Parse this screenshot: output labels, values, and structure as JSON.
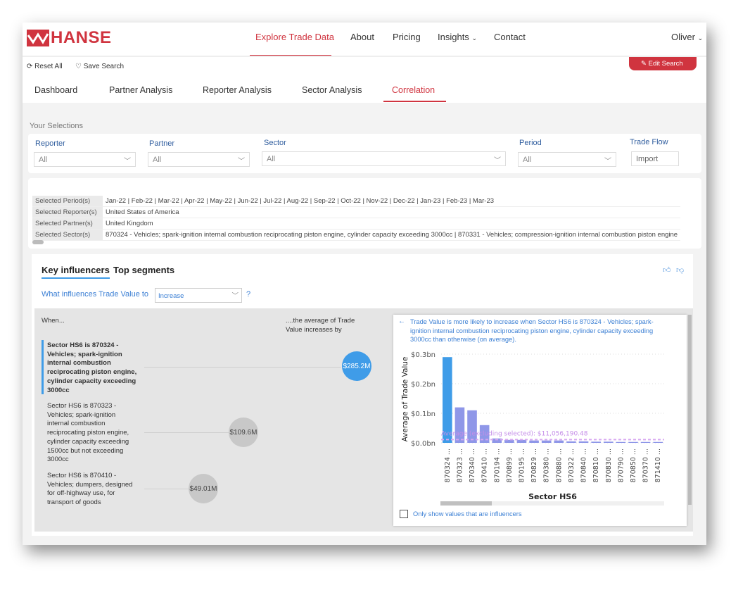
{
  "header": {
    "brand": "HANSE",
    "nav": [
      {
        "label": "Explore Trade Data",
        "active": true
      },
      {
        "label": "About"
      },
      {
        "label": "Pricing"
      },
      {
        "label": "Insights"
      },
      {
        "label": "Contact"
      }
    ],
    "user": "Oliver"
  },
  "toolbar": {
    "reset": "Reset All",
    "save": "Save Search",
    "edit": "Edit Search"
  },
  "tabs": [
    {
      "label": "Dashboard"
    },
    {
      "label": "Partner Analysis"
    },
    {
      "label": "Reporter Analysis"
    },
    {
      "label": "Sector Analysis"
    },
    {
      "label": "Correlation",
      "active": true
    }
  ],
  "selections": {
    "title": "Your Selections",
    "reporter": {
      "label": "Reporter",
      "value": "All"
    },
    "partner": {
      "label": "Partner",
      "value": "All"
    },
    "sector": {
      "label": "Sector",
      "value": "All"
    },
    "period": {
      "label": "Period",
      "value": "All"
    },
    "trade_flow": {
      "label": "Trade Flow",
      "value": "Import"
    }
  },
  "summary": [
    {
      "k": "Selected Period(s)",
      "v": "Jan-22 | Feb-22 | Mar-22 | Apr-22 | May-22 | Jun-22 | Jul-22 | Aug-22 | Sep-22 | Oct-22 | Nov-22 | Dec-22 | Jan-23 | Feb-23 | Mar-23"
    },
    {
      "k": "Selected Reporter(s)",
      "v": "United States of America"
    },
    {
      "k": "Selected Partner(s)",
      "v": "United Kingdom"
    },
    {
      "k": "Selected Sector(s)",
      "v": "870324 - Vehicles; spark-ignition internal combustion reciprocating piston engine, cylinder capacity exceeding 3000cc  |  870331 - Vehicles; compression-ignition internal combustion piston engine"
    }
  ],
  "ki": {
    "tabs": [
      "Key influencers",
      "Top segments"
    ],
    "question": "What influences Trade Value to",
    "dropdown": "Increase",
    "help": "?",
    "when": "When...",
    "avg_header": "....the average of Trade Value increases by",
    "influencers": [
      {
        "text": "Sector HS6 is 870324 - Vehicles; spark-ignition internal combustion reciprocating piston engine, cylinder capacity exceeding 3000cc",
        "value": "$285.2M",
        "selected": true
      },
      {
        "text": "Sector HS6 is 870323 - Vehicles; spark-ignition internal combustion reciprocating piston engine, cylinder capacity exceeding 1500cc but not exceeding 3000cc",
        "value": "$109.6M"
      },
      {
        "text": "Sector HS6 is 870410 - Vehicles; dumpers, designed for off-highway use, for transport of goods",
        "value": "$49.01M"
      }
    ],
    "detail": "Trade Value is more likely to increase when Sector HS6 is 870324 - Vehicles; spark-ignition internal combustion reciprocating piston engine, cylinder capacity exceeding 3000cc than otherwise (on average).",
    "checkbox": "Only show values that are influencers"
  },
  "chart_data": {
    "type": "bar",
    "xlabel": "Sector HS6",
    "ylabel": "Average of Trade Value",
    "ylim": [
      0,
      0.3
    ],
    "yticks": [
      "$0.0bn",
      "$0.1bn",
      "$0.2bn",
      "$0.3bn"
    ],
    "categories": [
      "870324 ...",
      "870323 ...",
      "870340 ...",
      "870410 ...",
      "870194 ...",
      "870899 ...",
      "870195 ...",
      "870829 ...",
      "870380 ...",
      "870880 ...",
      "870322 ...",
      "870840 ...",
      "870810 ...",
      "870830 ...",
      "870790 ...",
      "870850 ...",
      "870370 ...",
      "871410 ..."
    ],
    "values": [
      0.29,
      0.12,
      0.11,
      0.06,
      0.015,
      0.01,
      0.01,
      0.008,
      0.008,
      0.008,
      0.005,
      0.005,
      0.004,
      0.004,
      0.003,
      0.003,
      0.003,
      0.003
    ],
    "reference_line": {
      "label": "Average (excluding selected): $11,056,190.48",
      "value": 0.011
    },
    "colors": {
      "selected": "#3f9ce8",
      "other": "#8f97e8",
      "reference": "#d7a6f0"
    }
  }
}
